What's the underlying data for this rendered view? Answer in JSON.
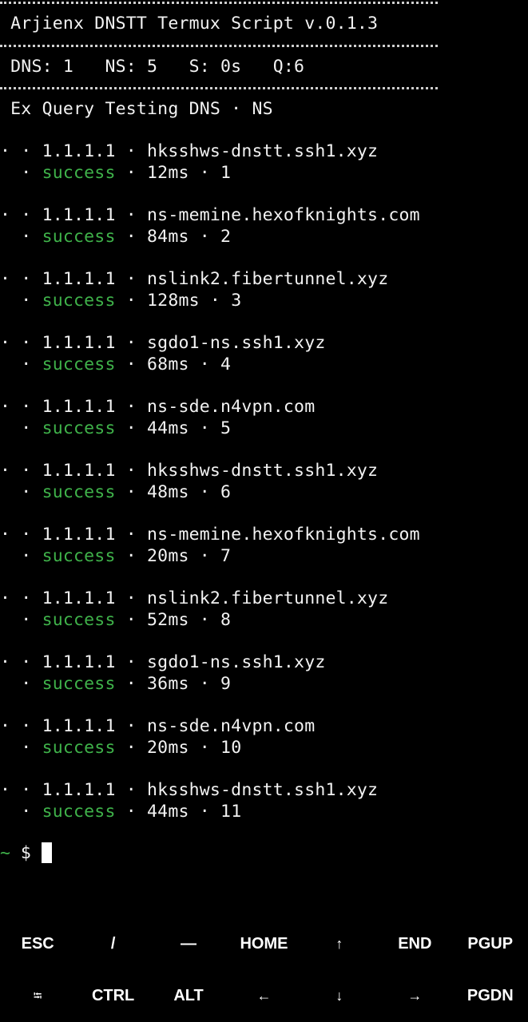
{
  "terminal": {
    "title": "Arjienx DNSTT Termux Script v.0.1.3",
    "stats": "DNS: 1   NS: 5   S: 0s   Q:6",
    "section": "Ex Query Testing DNS · NS",
    "query_prefix": "· · ",
    "sep": " · ",
    "result_prefix": "  · ",
    "entries": [
      {
        "dns": "1.1.1.1",
        "ns": "hksshws-dnstt.ssh1.xyz",
        "status": "success",
        "time": "12ms",
        "index": "1"
      },
      {
        "dns": "1.1.1.1",
        "ns": "ns-memine.hexofknights.com",
        "status": "success",
        "time": "84ms",
        "index": "2"
      },
      {
        "dns": "1.1.1.1",
        "ns": "nslink2.fibertunnel.xyz",
        "status": "success",
        "time": "128ms",
        "index": "3"
      },
      {
        "dns": "1.1.1.1",
        "ns": "sgdo1-ns.ssh1.xyz",
        "status": "success",
        "time": "68ms",
        "index": "4"
      },
      {
        "dns": "1.1.1.1",
        "ns": "ns-sde.n4vpn.com",
        "status": "success",
        "time": "44ms",
        "index": "5"
      },
      {
        "dns": "1.1.1.1",
        "ns": "hksshws-dnstt.ssh1.xyz",
        "status": "success",
        "time": "48ms",
        "index": "6"
      },
      {
        "dns": "1.1.1.1",
        "ns": "ns-memine.hexofknights.com",
        "status": "success",
        "time": "20ms",
        "index": "7"
      },
      {
        "dns": "1.1.1.1",
        "ns": "nslink2.fibertunnel.xyz",
        "status": "success",
        "time": "52ms",
        "index": "8"
      },
      {
        "dns": "1.1.1.1",
        "ns": "sgdo1-ns.ssh1.xyz",
        "status": "success",
        "time": "36ms",
        "index": "9"
      },
      {
        "dns": "1.1.1.1",
        "ns": "ns-sde.n4vpn.com",
        "status": "success",
        "time": "20ms",
        "index": "10"
      },
      {
        "dns": "1.1.1.1",
        "ns": "hksshws-dnstt.ssh1.xyz",
        "status": "success",
        "time": "44ms",
        "index": "11"
      }
    ],
    "prompt_tilde": "~",
    "prompt_symbol": "$"
  },
  "colors": {
    "background": "#000000",
    "text": "#f2f2f2",
    "success": "#3fb24a"
  },
  "extra_keys": {
    "row1": [
      {
        "label": "ESC",
        "name": "esc-key"
      },
      {
        "label": "/",
        "name": "slash-key"
      },
      {
        "label": "—",
        "name": "dash-key"
      },
      {
        "label": "HOME",
        "name": "home-key"
      },
      {
        "label": "↑",
        "name": "arrow-up-key"
      },
      {
        "label": "END",
        "name": "end-key"
      },
      {
        "label": "PGUP",
        "name": "pgup-key"
      }
    ],
    "row2": [
      {
        "label": "⭾",
        "name": "tab-key"
      },
      {
        "label": "CTRL",
        "name": "ctrl-key"
      },
      {
        "label": "ALT",
        "name": "alt-key"
      },
      {
        "label": "←",
        "name": "arrow-left-key"
      },
      {
        "label": "↓",
        "name": "arrow-down-key"
      },
      {
        "label": "→",
        "name": "arrow-right-key"
      },
      {
        "label": "PGDN",
        "name": "pgdn-key"
      }
    ]
  }
}
